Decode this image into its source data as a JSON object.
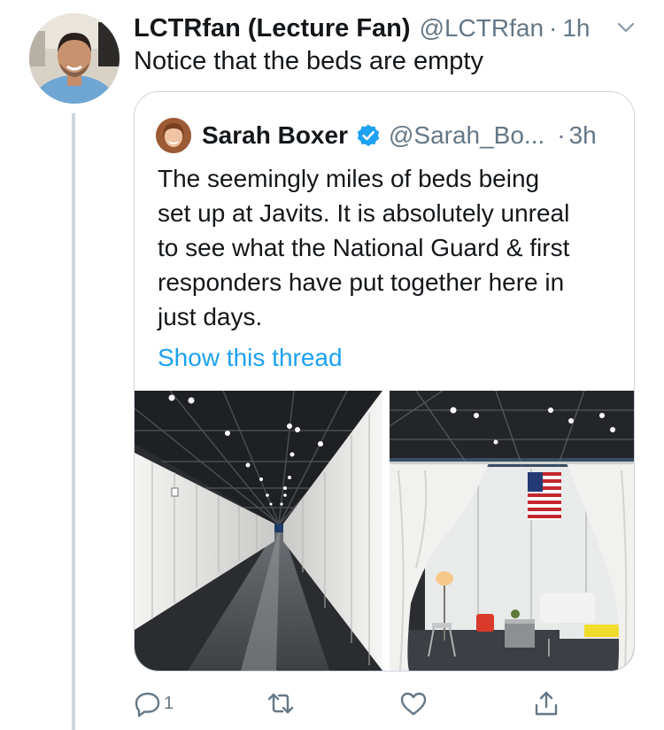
{
  "tweet": {
    "display_name": "LCTRfan (Lecture Fan)",
    "handle": "@LCTRfan",
    "separator": "·",
    "time": "1h",
    "text": "Notice that the beds are empty"
  },
  "quoted_tweet": {
    "display_name": "Sarah Boxer",
    "handle": "@Sarah_Bo...",
    "separator": "·",
    "time": "3h",
    "text_lines": [
      "The seemingly miles of beds being",
      "set up at Javits. It is absolutely unreal",
      "to see what the National Guard & first",
      "responders have put together here in",
      "just days."
    ],
    "show_thread": "Show this thread"
  },
  "actions": {
    "reply_count": "1",
    "icons": [
      "reply-icon",
      "retweet-icon",
      "like-icon",
      "share-icon"
    ]
  },
  "colors": {
    "link": "#1da1f2",
    "secondary_text": "#657786",
    "border": "#ccd6dd",
    "verified": "#1da1f2"
  }
}
